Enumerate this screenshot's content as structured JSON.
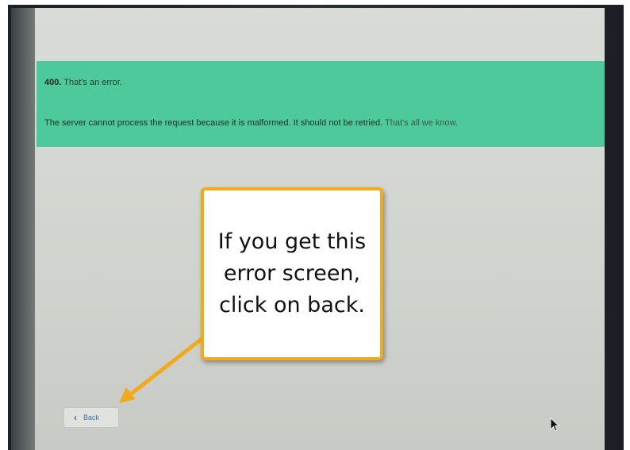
{
  "error": {
    "code": "400.",
    "title": "That's an error.",
    "message": "The server cannot process the request because it is malformed. It should not be retried.",
    "footer": "That's all we know."
  },
  "callout": {
    "text": "If you get this error screen, click on back."
  },
  "navigation": {
    "back_label": "Back",
    "back_icon": "chevron-left-icon"
  },
  "colors": {
    "banner": "#4dc99b",
    "callout_border": "#f0ab1c",
    "arrow": "#f0ab1c",
    "link": "#3b6fa8"
  }
}
